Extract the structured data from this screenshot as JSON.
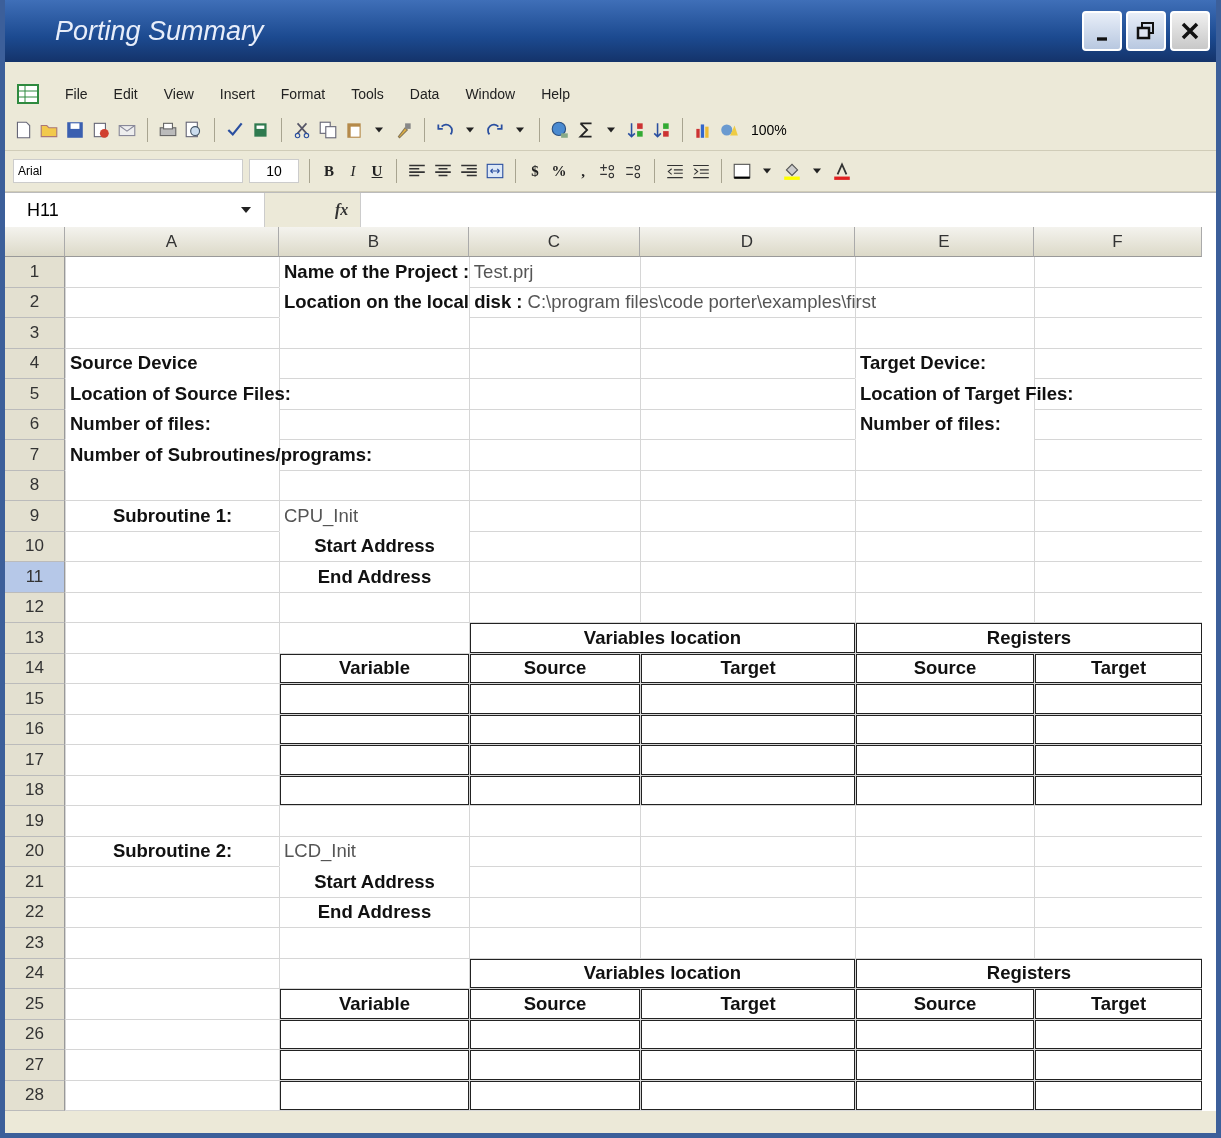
{
  "window": {
    "title": "Porting Summary"
  },
  "menu": [
    "File",
    "Edit",
    "View",
    "Insert",
    "Format",
    "Tools",
    "Data",
    "Window",
    "Help"
  ],
  "standard_toolbar": [
    {
      "kind": "new"
    },
    {
      "kind": "open"
    },
    {
      "kind": "save"
    },
    {
      "kind": "permission"
    },
    {
      "kind": "mail"
    },
    {
      "kind": "separator"
    },
    {
      "kind": "print"
    },
    {
      "kind": "preview"
    },
    {
      "kind": "separator"
    },
    {
      "kind": "spelling"
    },
    {
      "kind": "research"
    },
    {
      "kind": "separator"
    },
    {
      "kind": "cut"
    },
    {
      "kind": "copy"
    },
    {
      "kind": "paste"
    },
    {
      "kind": "dropdown"
    },
    {
      "kind": "brush"
    },
    {
      "kind": "separator"
    },
    {
      "kind": "undo"
    },
    {
      "kind": "dropdown"
    },
    {
      "kind": "redo"
    },
    {
      "kind": "dropdown"
    },
    {
      "kind": "separator"
    },
    {
      "kind": "hyperlink"
    },
    {
      "kind": "sum"
    },
    {
      "kind": "dropdown"
    },
    {
      "kind": "sort-asc"
    },
    {
      "kind": "sort-desc"
    },
    {
      "kind": "separator"
    },
    {
      "kind": "chart"
    },
    {
      "kind": "drawing"
    },
    {
      "kind": "zoom",
      "label": "100%"
    }
  ],
  "formatting_toolbar": [
    {
      "kind": "font",
      "label": "Arial"
    },
    {
      "kind": "size",
      "label": "10"
    },
    {
      "kind": "separator"
    },
    {
      "kind": "bold",
      "label": "B"
    },
    {
      "kind": "italic",
      "label": "I"
    },
    {
      "kind": "underline",
      "label": "U"
    },
    {
      "kind": "separator"
    },
    {
      "kind": "align-left"
    },
    {
      "kind": "align-center"
    },
    {
      "kind": "align-right"
    },
    {
      "kind": "merge"
    },
    {
      "kind": "separator"
    },
    {
      "kind": "plain",
      "label": "$"
    },
    {
      "kind": "plain",
      "label": "%"
    },
    {
      "kind": "plain",
      "label": ","
    },
    {
      "kind": "inc-decimal"
    },
    {
      "kind": "dec-decimal"
    },
    {
      "kind": "separator"
    },
    {
      "kind": "outdent"
    },
    {
      "kind": "indent"
    },
    {
      "kind": "separator"
    },
    {
      "kind": "borders"
    },
    {
      "kind": "dropdown"
    },
    {
      "kind": "fill"
    },
    {
      "kind": "dropdown"
    },
    {
      "kind": "font-color"
    }
  ],
  "formula_bar": {
    "name_box": "H11",
    "function_label": "fx"
  },
  "columns": [
    "A",
    "B",
    "C",
    "D",
    "E",
    "F"
  ],
  "rows": [
    {
      "number": "1",
      "selected": false,
      "cells": [
        {
          "boxed": false
        },
        {
          "boxed": false,
          "centered": false,
          "text": "**Name of the Project :** Test.prj"
        },
        {
          "boxed": false
        },
        {
          "boxed": false
        },
        {
          "boxed": false
        },
        {
          "boxed": false
        }
      ]
    },
    {
      "number": "2",
      "selected": false,
      "cells": [
        {
          "boxed": false
        },
        {
          "boxed": false,
          "centered": false,
          "text": "**Location on the local disk :** C:\\program files\\code porter\\examples\\first"
        },
        {
          "boxed": false
        },
        {
          "boxed": false
        },
        {
          "boxed": false
        },
        {
          "boxed": false
        }
      ]
    },
    {
      "number": "3",
      "selected": false,
      "cells": [
        {
          "boxed": false
        },
        {
          "boxed": false
        },
        {
          "boxed": false
        },
        {
          "boxed": false
        },
        {
          "boxed": false
        },
        {
          "boxed": false
        }
      ]
    },
    {
      "number": "4",
      "selected": false,
      "cells": [
        {
          "boxed": false,
          "centered": false,
          "text": "**Source Device**"
        },
        {
          "boxed": false
        },
        {
          "boxed": false
        },
        {
          "boxed": false
        },
        {
          "boxed": false,
          "centered": false,
          "text": "**Target Device:**"
        },
        {
          "boxed": false
        }
      ]
    },
    {
      "number": "5",
      "selected": false,
      "cells": [
        {
          "boxed": false,
          "centered": false,
          "text": "**Location of Source Files:**"
        },
        {
          "boxed": false
        },
        {
          "boxed": false
        },
        {
          "boxed": false
        },
        {
          "boxed": false,
          "centered": false,
          "text": "**Location of Target Files:**"
        },
        {
          "boxed": false
        }
      ]
    },
    {
      "number": "6",
      "selected": false,
      "cells": [
        {
          "boxed": false,
          "centered": false,
          "text": "**Number of files:**"
        },
        {
          "boxed": false
        },
        {
          "boxed": false
        },
        {
          "boxed": false
        },
        {
          "boxed": false,
          "centered": false,
          "text": "**Number of files:**"
        },
        {
          "boxed": false
        }
      ]
    },
    {
      "number": "7",
      "selected": false,
      "cells": [
        {
          "boxed": false,
          "centered": false,
          "text": "**Number of Subroutines/programs:**"
        },
        {
          "boxed": false
        },
        {
          "boxed": false
        },
        {
          "boxed": false
        },
        {
          "boxed": false
        },
        {
          "boxed": false
        }
      ]
    },
    {
      "number": "8",
      "selected": false,
      "cells": [
        {
          "boxed": false
        },
        {
          "boxed": false
        },
        {
          "boxed": false
        },
        {
          "boxed": false
        },
        {
          "boxed": false
        },
        {
          "boxed": false
        }
      ]
    },
    {
      "number": "9",
      "selected": false,
      "cells": [
        {
          "boxed": false,
          "centered": true,
          "text": "**Subroutine 1:**"
        },
        {
          "boxed": false,
          "centered": false,
          "text": "CPU_Init"
        },
        {
          "boxed": false
        },
        {
          "boxed": false
        },
        {
          "boxed": false
        },
        {
          "boxed": false
        }
      ]
    },
    {
      "number": "10",
      "selected": false,
      "cells": [
        {
          "boxed": false
        },
        {
          "boxed": false,
          "centered": true,
          "text": "**Start Address**"
        },
        {
          "boxed": false
        },
        {
          "boxed": false
        },
        {
          "boxed": false
        },
        {
          "boxed": false
        }
      ]
    },
    {
      "number": "11",
      "selected": true,
      "cells": [
        {
          "boxed": false
        },
        {
          "boxed": false,
          "centered": true,
          "text": "**End Address**"
        },
        {
          "boxed": false
        },
        {
          "boxed": false
        },
        {
          "boxed": false
        },
        {
          "boxed": false
        }
      ]
    },
    {
      "number": "12",
      "selected": false,
      "cells": [
        {
          "boxed": false
        },
        {
          "boxed": false
        },
        {
          "boxed": false
        },
        {
          "boxed": false
        },
        {
          "boxed": false
        },
        {
          "boxed": false
        }
      ]
    },
    {
      "number": "13",
      "selected": false,
      "cells": [
        {
          "boxed": false,
          "merged": false
        },
        {
          "boxed": false,
          "merged": false
        },
        {
          "boxed": true,
          "merged": true,
          "centered": true,
          "text": "**Variables location**"
        },
        {
          "boxed": true,
          "merged": true,
          "centered": true,
          "text": "**Registers**"
        }
      ]
    },
    {
      "number": "14",
      "selected": false,
      "cells": [
        {
          "boxed": false
        },
        {
          "boxed": true,
          "centered": true,
          "text": "**Variable**"
        },
        {
          "boxed": true,
          "centered": true,
          "text": "**Source**"
        },
        {
          "boxed": true,
          "centered": true,
          "text": "**Target**"
        },
        {
          "boxed": true,
          "centered": true,
          "text": "**Source**"
        },
        {
          "boxed": true,
          "centered": true,
          "text": "**Target**"
        }
      ]
    },
    {
      "number": "15",
      "selected": false,
      "cells": [
        {
          "boxed": false
        },
        {
          "boxed": true
        },
        {
          "boxed": true
        },
        {
          "boxed": true
        },
        {
          "boxed": true
        },
        {
          "boxed": true
        }
      ]
    },
    {
      "number": "16",
      "selected": false,
      "cells": [
        {
          "boxed": false
        },
        {
          "boxed": true
        },
        {
          "boxed": true
        },
        {
          "boxed": true
        },
        {
          "boxed": true
        },
        {
          "boxed": true
        }
      ]
    },
    {
      "number": "17",
      "selected": false,
      "cells": [
        {
          "boxed": false
        },
        {
          "boxed": true
        },
        {
          "boxed": true
        },
        {
          "boxed": true
        },
        {
          "boxed": true
        },
        {
          "boxed": true
        }
      ]
    },
    {
      "number": "18",
      "selected": false,
      "cells": [
        {
          "boxed": false
        },
        {
          "boxed": true
        },
        {
          "boxed": true
        },
        {
          "boxed": true
        },
        {
          "boxed": true
        },
        {
          "boxed": true
        }
      ]
    },
    {
      "number": "19",
      "selected": false,
      "cells": [
        {
          "boxed": false
        },
        {
          "boxed": false
        },
        {
          "boxed": false
        },
        {
          "boxed": false
        },
        {
          "boxed": false
        },
        {
          "boxed": false
        }
      ]
    },
    {
      "number": "20",
      "selected": false,
      "cells": [
        {
          "boxed": false,
          "centered": true,
          "text": "**Subroutine 2:**"
        },
        {
          "boxed": false,
          "centered": false,
          "text": "LCD_Init"
        },
        {
          "boxed": false
        },
        {
          "boxed": false
        },
        {
          "boxed": false
        },
        {
          "boxed": false
        }
      ]
    },
    {
      "number": "21",
      "selected": false,
      "cells": [
        {
          "boxed": false
        },
        {
          "boxed": false,
          "centered": true,
          "text": "**Start Address**"
        },
        {
          "boxed": false
        },
        {
          "boxed": false
        },
        {
          "boxed": false
        },
        {
          "boxed": false
        }
      ]
    },
    {
      "number": "22",
      "selected": false,
      "cells": [
        {
          "boxed": false
        },
        {
          "boxed": false,
          "centered": true,
          "text": "**End Address**"
        },
        {
          "boxed": false
        },
        {
          "boxed": false
        },
        {
          "boxed": false
        },
        {
          "boxed": false
        }
      ]
    },
    {
      "number": "23",
      "selected": false,
      "cells": [
        {
          "boxed": false
        },
        {
          "boxed": false
        },
        {
          "boxed": false
        },
        {
          "boxed": false
        },
        {
          "boxed": false
        },
        {
          "boxed": false
        }
      ]
    },
    {
      "number": "24",
      "selected": false,
      "cells": [
        {
          "boxed": false,
          "merged": false
        },
        {
          "boxed": false,
          "merged": false
        },
        {
          "boxed": true,
          "merged": true,
          "centered": true,
          "text": "**Variables location**"
        },
        {
          "boxed": true,
          "merged": true,
          "centered": true,
          "text": "**Registers**"
        }
      ]
    },
    {
      "number": "25",
      "selected": false,
      "cells": [
        {
          "boxed": false
        },
        {
          "boxed": true,
          "centered": true,
          "text": "**Variable**"
        },
        {
          "boxed": true,
          "centered": true,
          "text": "**Source**"
        },
        {
          "boxed": true,
          "centered": true,
          "text": "**Target**"
        },
        {
          "boxed": true,
          "centered": true,
          "text": "**Source**"
        },
        {
          "boxed": true,
          "centered": true,
          "text": "**Target**"
        }
      ]
    },
    {
      "number": "26",
      "selected": false,
      "cells": [
        {
          "boxed": false
        },
        {
          "boxed": true
        },
        {
          "boxed": true
        },
        {
          "boxed": true
        },
        {
          "boxed": true
        },
        {
          "boxed": true
        }
      ]
    },
    {
      "number": "27",
      "selected": false,
      "cells": [
        {
          "boxed": false
        },
        {
          "boxed": true
        },
        {
          "boxed": true
        },
        {
          "boxed": true
        },
        {
          "boxed": true
        },
        {
          "boxed": true
        }
      ]
    },
    {
      "number": "28",
      "selected": false,
      "cells": [
        {
          "boxed": false
        },
        {
          "boxed": true
        },
        {
          "boxed": true
        },
        {
          "boxed": true
        },
        {
          "boxed": true
        },
        {
          "boxed": true
        }
      ]
    }
  ]
}
